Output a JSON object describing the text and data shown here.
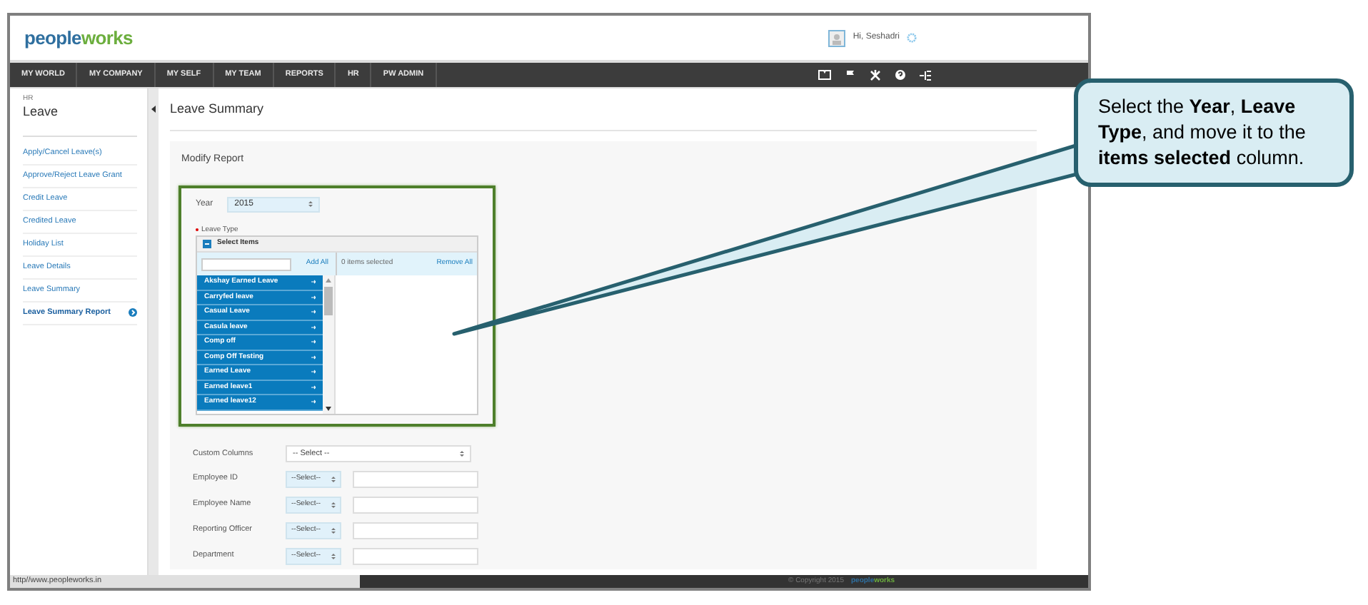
{
  "header": {
    "logo": "peopleworks",
    "greeting": "Hi, Seshadri"
  },
  "nav": {
    "items": [
      "MY WORLD",
      "MY COMPANY",
      "MY SELF",
      "MY TEAM",
      "REPORTS",
      "HR",
      "PW ADMIN"
    ]
  },
  "sidebar": {
    "section_label": "HR",
    "title": "Leave",
    "items": [
      {
        "label": "Apply/Cancel Leave(s)",
        "selected": false
      },
      {
        "label": "Approve/Reject Leave Grant",
        "selected": false
      },
      {
        "label": "Credit Leave",
        "selected": false
      },
      {
        "label": "Credited Leave",
        "selected": false
      },
      {
        "label": "Holiday List",
        "selected": false
      },
      {
        "label": "Leave Details",
        "selected": false
      },
      {
        "label": "Leave Summary",
        "selected": false
      },
      {
        "label": "Leave Summary Report",
        "selected": true
      }
    ]
  },
  "page_title": "Leave Summary",
  "panel_title": "Modify Report",
  "year": {
    "label": "Year",
    "value": "2015"
  },
  "leave_type": {
    "label": "Leave Type",
    "header": "Select Items",
    "add_all": "Add All",
    "selected_count": "0 items selected",
    "remove_all": "Remove All",
    "items": [
      "Akshay Earned Leave",
      "Carryfed leave",
      "Casual Leave",
      "Casula leave",
      "Comp off",
      "Comp Off Testing",
      "Earned Leave",
      "Earned leave1",
      "Earned leave12"
    ]
  },
  "custom_columns": {
    "label": "Custom Columns",
    "value": "-- Select --"
  },
  "filters": [
    {
      "label": "Employee ID",
      "operator": "--Select--"
    },
    {
      "label": "Employee Name",
      "operator": "--Select--"
    },
    {
      "label": "Reporting Officer",
      "operator": "--Select--"
    },
    {
      "label": "Department",
      "operator": "--Select--"
    }
  ],
  "status_bar": "http//www.peopleworks.in",
  "footer": {
    "copyright": "© Copyright 2015",
    "logo": "peopleworks"
  },
  "callout": "Select the **Year**, **Leave Type**, and move it to the **items selected** column."
}
